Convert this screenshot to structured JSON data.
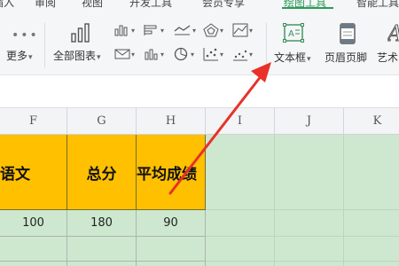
{
  "ribbon_tabs": [
    {
      "label": "插入"
    },
    {
      "label": "审阅"
    },
    {
      "label": "视图"
    },
    {
      "label": "开发工具"
    },
    {
      "label": "会员专享"
    },
    {
      "label": "绘图工具"
    },
    {
      "label": "智能工具"
    }
  ],
  "ribbon": {
    "more_label": "更多",
    "all_charts_label": "全部图表",
    "textbox_label": "文本框",
    "header_footer_label": "页眉页脚",
    "art_label": "艺术"
  },
  "columns": [
    "F",
    "G",
    "H",
    "I",
    "J",
    "K"
  ],
  "table": {
    "headers": [
      "语文",
      "总分",
      "平均成绩"
    ],
    "row1": [
      "100",
      "180",
      "90"
    ]
  },
  "colors": {
    "accent": "#2e9a5a",
    "header_fill": "#ffc000",
    "sheet_green": "#cde8cf",
    "arrow": "#e8312a"
  },
  "icons": [
    "more-icon",
    "all-charts-icon",
    "bar-chart-icon",
    "line-chart-icon",
    "radar-chart-icon",
    "area-chart-icon",
    "pie-chart-icon",
    "scatter-chart-icon",
    "textbox-icon",
    "header-footer-icon",
    "wordart-icon"
  ]
}
